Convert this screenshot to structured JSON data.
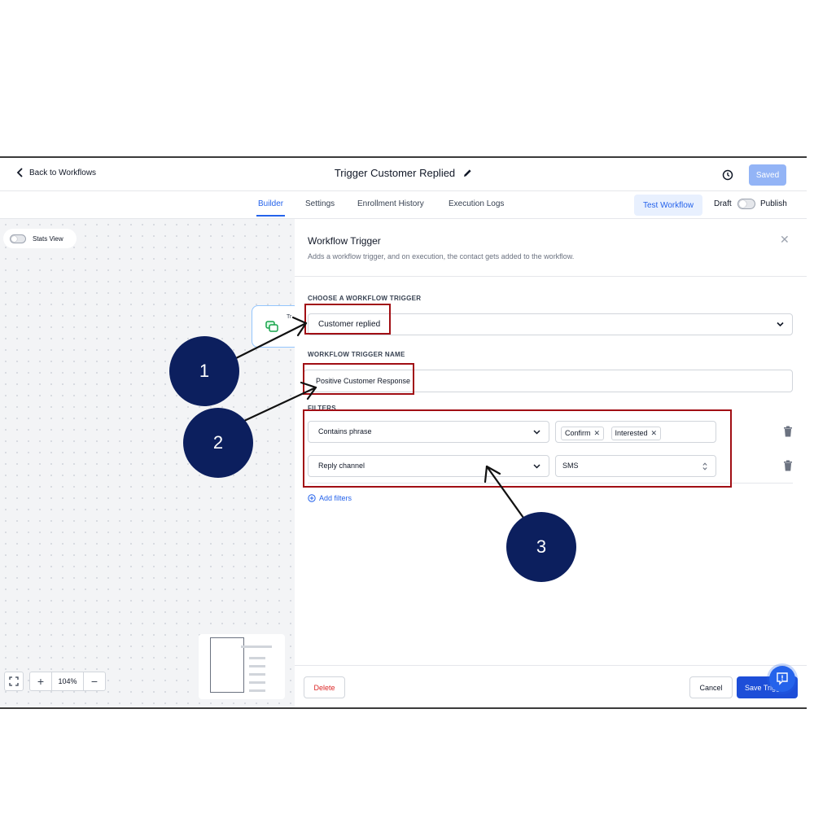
{
  "topbar": {
    "back_label": "Back to Workflows",
    "title": "Trigger Customer Replied",
    "saved_label": "Saved"
  },
  "tabs": {
    "items": [
      {
        "label": "Builder",
        "active": true
      },
      {
        "label": "Settings",
        "active": false
      },
      {
        "label": "Enrollment History",
        "active": false
      },
      {
        "label": "Execution Logs",
        "active": false
      }
    ],
    "test_workflow_label": "Test Workflow",
    "draft_label": "Draft",
    "publish_label": "Publish",
    "published": false
  },
  "canvas": {
    "stats_view_label": "Stats View",
    "stats_view_on": false,
    "zoom_value": "104%",
    "zoom_in_symbol": "+",
    "zoom_out_symbol": "−",
    "fit_icon": "expand-icon",
    "trigger_node_label": "Tr"
  },
  "panel": {
    "title": "Workflow Trigger",
    "description": "Adds a workflow trigger, and on execution, the contact gets added to the workflow.",
    "choose_trigger_label": "CHOOSE A WORKFLOW TRIGGER",
    "trigger_value": "Customer replied",
    "trigger_name_label": "WORKFLOW TRIGGER NAME",
    "trigger_name_value": "Positive Customer Response",
    "filters_label": "FILTERS",
    "filters": [
      {
        "field": "Contains phrase",
        "tags": [
          "Confirm",
          "Interested"
        ]
      },
      {
        "field": "Reply channel",
        "value": "SMS"
      }
    ],
    "add_filters_label": "Add filters",
    "delete_label": "Delete",
    "cancel_label": "Cancel",
    "save_label": "Save Trigger"
  },
  "annotations": {
    "callouts": [
      "1",
      "2",
      "3"
    ],
    "highlight_color": "#a10e14",
    "callout_color": "#0c1f5e"
  },
  "colors": {
    "accent": "#2563eb",
    "saved_button": "#93b4f6",
    "danger": "#dc2626"
  }
}
